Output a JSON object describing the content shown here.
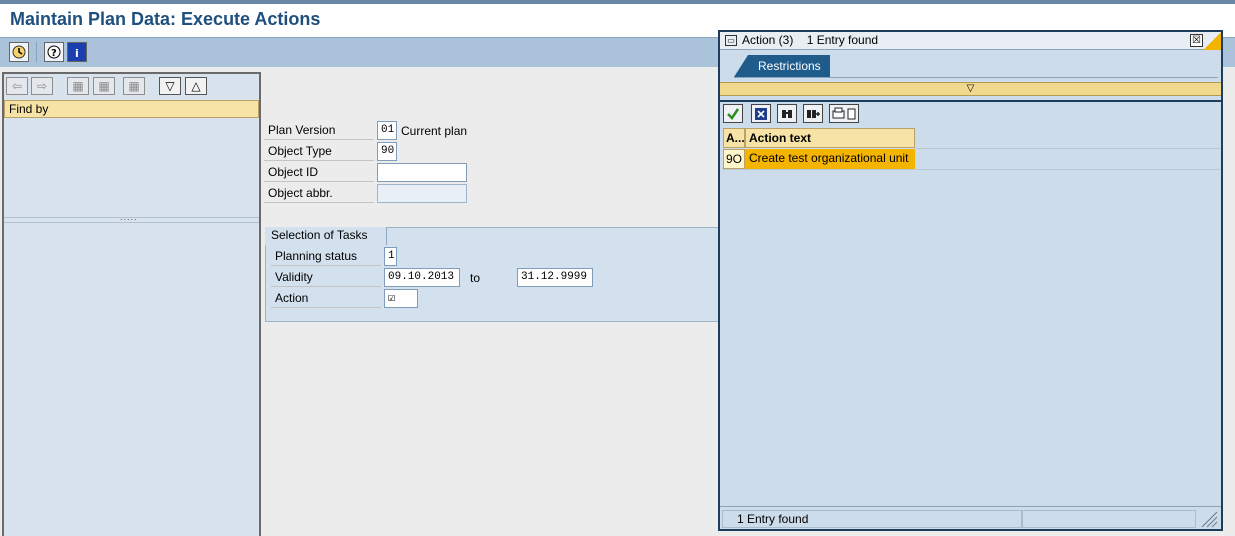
{
  "window": {
    "title": "Maintain Plan Data: Execute Actions"
  },
  "toolbar": {
    "execute_icon": "clock-execute-icon",
    "help_icon": "help-icon",
    "info_icon": "info-icon"
  },
  "left_panel": {
    "find_by_label": "Find by",
    "nav_buttons": [
      "back-icon",
      "forward-icon",
      "tree-1-icon",
      "tree-2-icon",
      "tree-3-icon",
      "expand-down-icon",
      "collapse-up-icon"
    ],
    "splitter_dots": "....."
  },
  "form": {
    "plan_version_label": "Plan Version",
    "plan_version_value": "01",
    "plan_version_text": "Current plan",
    "object_type_label": "Object Type",
    "object_type_value": "90",
    "object_id_label": "Object ID",
    "object_id_value": "",
    "object_abbr_label": "Object abbr.",
    "object_abbr_value": ""
  },
  "selection": {
    "group_title": "Selection of Tasks",
    "planning_status_label": "Planning status",
    "planning_status_value": "1",
    "validity_label": "Validity",
    "validity_from": "09.10.2013",
    "to_label": "to",
    "validity_to": "31.12.9999",
    "action_label": "Action",
    "action_value": "☑"
  },
  "popup": {
    "title": "Action (3)",
    "entries_found": "1 Entry found",
    "close_glyph": "☒",
    "restrictions_tab": "Restrictions",
    "collapse_glyph": "▽",
    "toolbar_icons": [
      "ok-check-icon",
      "cancel-icon",
      "find-icon",
      "find-next-icon",
      "print-icon"
    ],
    "columns": [
      "A...",
      "Action text"
    ],
    "rows": [
      {
        "code": "9O",
        "text": "Create test organizational unit"
      }
    ],
    "status": "1 Entry found"
  },
  "colors": {
    "title_blue": "#1f4f7e",
    "toolbar_bg": "#abc3da",
    "selected_row": "#f4b400",
    "tab_blue": "#1f5c8c"
  }
}
